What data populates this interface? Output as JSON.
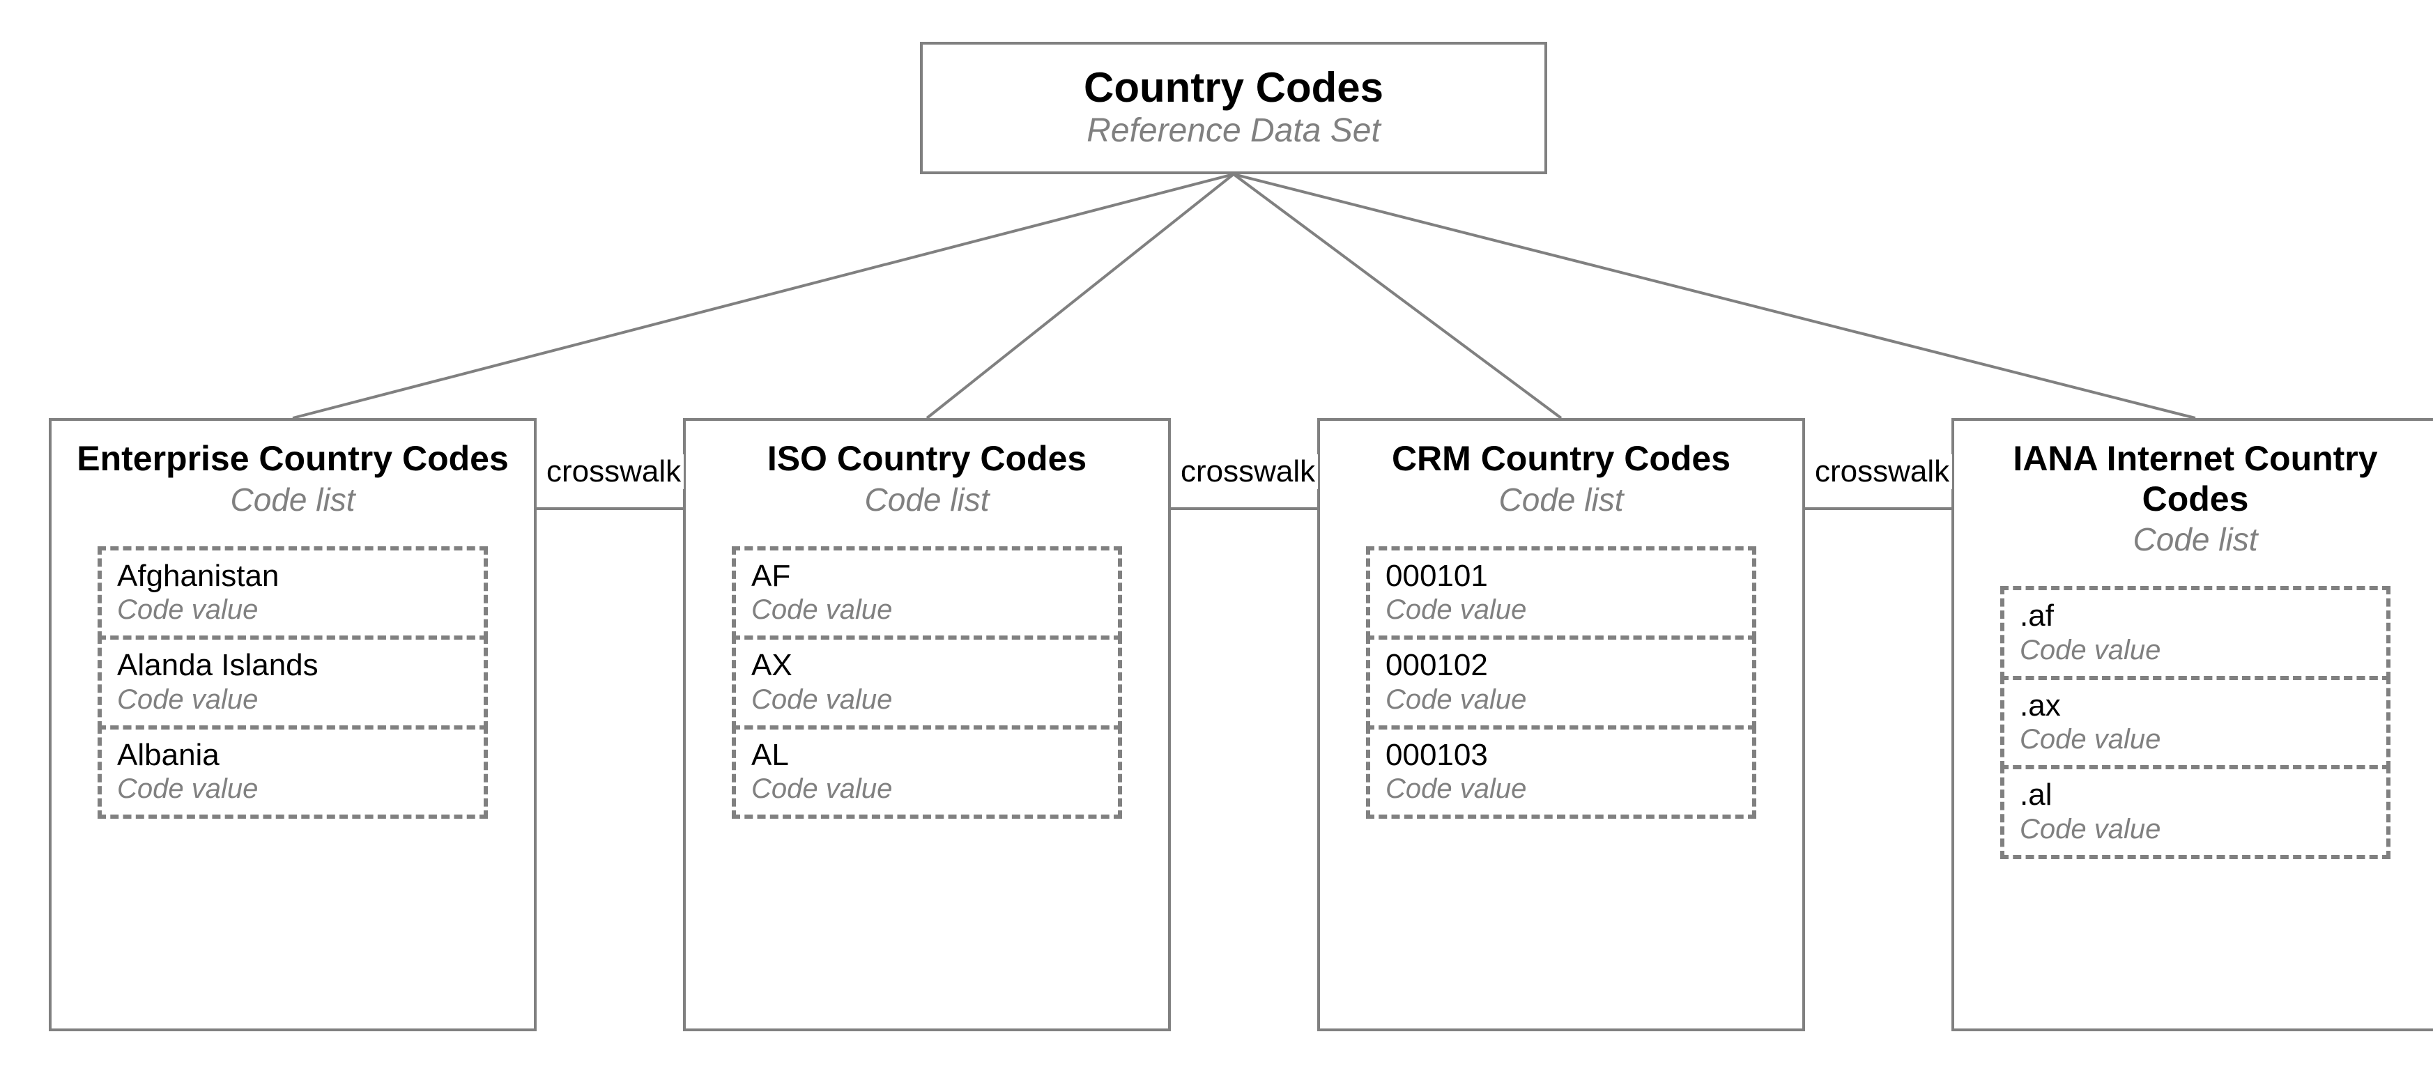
{
  "root": {
    "title": "Country Codes",
    "subtitle": "Reference Data Set"
  },
  "crosswalk_label": "crosswalk",
  "code_value_label": "Code value",
  "lists": [
    {
      "title": "Enterprise Country Codes",
      "subtitle": "Code list",
      "values": [
        "Afghanistan",
        "Alanda Islands",
        "Albania"
      ]
    },
    {
      "title": "ISO Country Codes",
      "subtitle": "Code list",
      "values": [
        "AF",
        "AX",
        "AL"
      ]
    },
    {
      "title": "CRM Country Codes",
      "subtitle": "Code list",
      "values": [
        "000101",
        "000102",
        "000103"
      ]
    },
    {
      "title": "IANA Internet Country Codes",
      "subtitle": "Code list",
      "values": [
        ".af",
        ".ax",
        ".al"
      ]
    }
  ]
}
